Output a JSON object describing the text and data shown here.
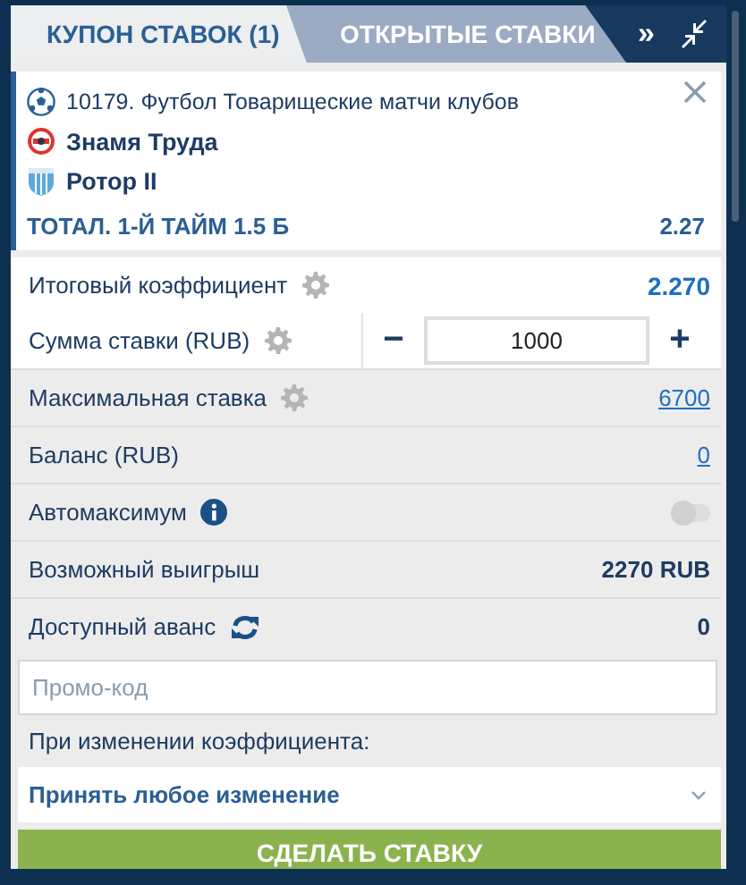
{
  "tabs": [
    {
      "label": "КУПОН СТАВОК (1)",
      "selected": true
    },
    {
      "label": "ОТКРЫТЫЕ СТАВКИ",
      "selected": false
    }
  ],
  "toolbar": {
    "expand": "»"
  },
  "bet": {
    "event": "10179. Футбол Товарищеские матчи клубов",
    "teams": [
      {
        "name": "Знамя Труда",
        "kind": "red"
      },
      {
        "name": "Ротор II",
        "kind": "blue"
      }
    ],
    "market": "ТОТАЛ. 1-Й ТАЙМ 1.5 Б",
    "odds": "2.27"
  },
  "rows": [
    {
      "kind": "coefficient",
      "label": "Итоговый коэффициент",
      "value": "2.270"
    },
    {
      "kind": "stake",
      "label": "Сумма ставки (RUB)",
      "minus": "−",
      "value": "1000",
      "plus": "+"
    },
    {
      "kind": "limit",
      "label": "Максимальная ставка",
      "value": "6700"
    },
    {
      "kind": "balance",
      "label": "Баланс (RUB)",
      "value": "0"
    },
    {
      "kind": "toggle",
      "label": "Автомаксимум",
      "on": false
    },
    {
      "kind": "win",
      "label": "Возможный выигрыш",
      "value": "2270 RUB"
    },
    {
      "kind": "advance",
      "label": "Доступный аванс",
      "value": "0"
    }
  ],
  "promo": {
    "placeholder": "Промо-код"
  },
  "odds_change": {
    "label": "При изменении коэффициента:",
    "value": "Принять любое изменение"
  },
  "submit": "СДЕЛАТЬ СТАВКУ"
}
